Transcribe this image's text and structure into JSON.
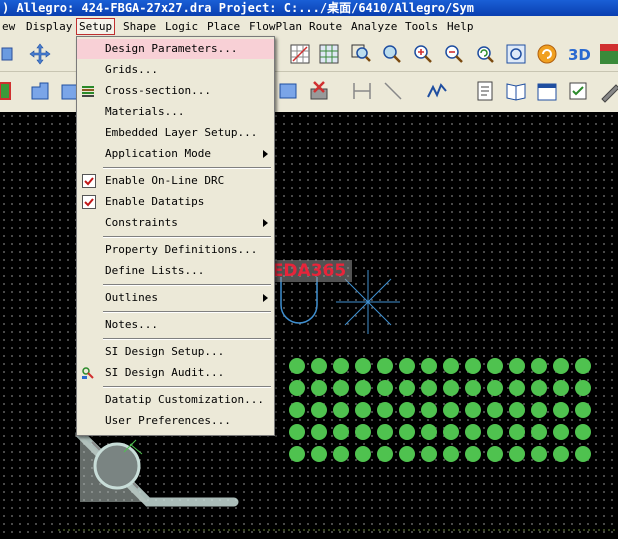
{
  "title_bar": {
    "text": ") Allegro: 424-FBGA-27x27.dra  Project: C:.../桌面/6410/Allegro/Sym"
  },
  "menubar": [
    {
      "label": "ew"
    },
    {
      "label": "Display"
    },
    {
      "label": "Setup"
    },
    {
      "label": "Shape"
    },
    {
      "label": "Logic"
    },
    {
      "label": "Place"
    },
    {
      "label": "FlowPlan"
    },
    {
      "label": "Route"
    },
    {
      "label": "Analyze"
    },
    {
      "label": "Tools"
    },
    {
      "label": "Help"
    }
  ],
  "setup_menu": {
    "items": [
      {
        "label": "Design Parameters...",
        "highlighted": true
      },
      {
        "label": "Grids..."
      },
      {
        "label": "Cross-section...",
        "icon": "cross-section-icon"
      },
      {
        "label": "Materials..."
      },
      {
        "label": "Embedded Layer Setup..."
      },
      {
        "label": "Application Mode",
        "submenu": true
      },
      {
        "label": "Enable On-Line DRC",
        "checked": true
      },
      {
        "label": "Enable Datatips",
        "checked": true
      },
      {
        "label": "Constraints",
        "submenu": true
      },
      {
        "label": "Property Definitions..."
      },
      {
        "label": "Define Lists..."
      },
      {
        "label": "Outlines",
        "submenu": true
      },
      {
        "label": "Notes..."
      },
      {
        "label": "SI Design Setup..."
      },
      {
        "label": "SI Design Audit...",
        "icon": "si-audit-icon"
      },
      {
        "label": "Datatip Customization..."
      },
      {
        "label": "User Preferences..."
      }
    ]
  },
  "canvas": {
    "watermark": "EDA365",
    "pad_color": "#4fc24f",
    "outline_color": "#3f8fd0"
  },
  "colors": {
    "menu_bg": "#ece9d8",
    "highlight": "#f8d0d6",
    "title_bar": "#0a3fb0"
  }
}
